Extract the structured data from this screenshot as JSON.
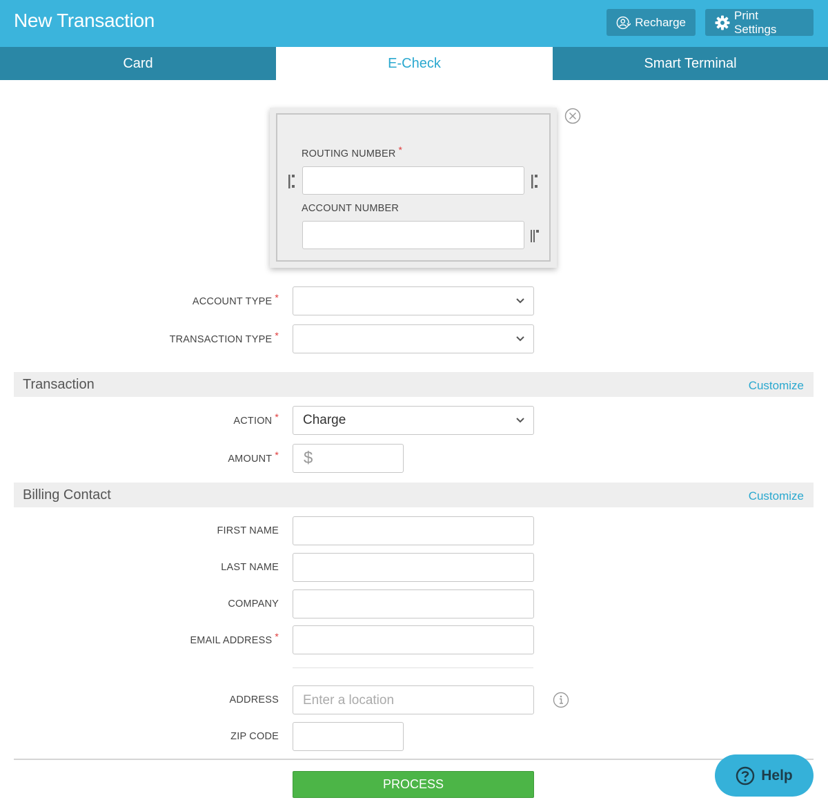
{
  "header": {
    "title": "New Transaction",
    "recharge_label": "Recharge",
    "print_label": "Print Settings"
  },
  "tabs": [
    {
      "label": "Card",
      "active": false
    },
    {
      "label": "E-Check",
      "active": true
    },
    {
      "label": "Smart Terminal",
      "active": false
    }
  ],
  "check": {
    "routing_label": "ROUTING NUMBER",
    "routing_value": "",
    "account_label": "ACCOUNT NUMBER",
    "account_value": "",
    "required_mark": "*"
  },
  "account_details": {
    "account_type_label": "ACCOUNT TYPE",
    "account_type_value": "",
    "transaction_type_label": "TRANSACTION TYPE",
    "transaction_type_value": ""
  },
  "transaction": {
    "section_title": "Transaction",
    "customize_label": "Customize",
    "action_label": "ACTION",
    "action_value": "Charge",
    "amount_label": "AMOUNT",
    "amount_currency": "$",
    "amount_value": ""
  },
  "billing": {
    "section_title": "Billing Contact",
    "customize_label": "Customize",
    "first_name_label": "FIRST NAME",
    "last_name_label": "LAST NAME",
    "company_label": "COMPANY",
    "email_label": "EMAIL ADDRESS",
    "address_label": "ADDRESS",
    "address_placeholder": "Enter a location",
    "zip_label": "ZIP CODE"
  },
  "actions": {
    "process_label": "PROCESS",
    "help_label": "Help"
  },
  "colors": {
    "header": "#3bb4dc",
    "tabs": "#2a87a6",
    "accent": "#2aa8cf",
    "process": "#4cb547",
    "required": "#e03a3a"
  },
  "icons": [
    "user-refresh-icon",
    "gear-icon",
    "close-circle-icon",
    "micr-transit-icon",
    "micr-onus-icon",
    "info-icon",
    "question-icon",
    "chevron-down-icon"
  ]
}
